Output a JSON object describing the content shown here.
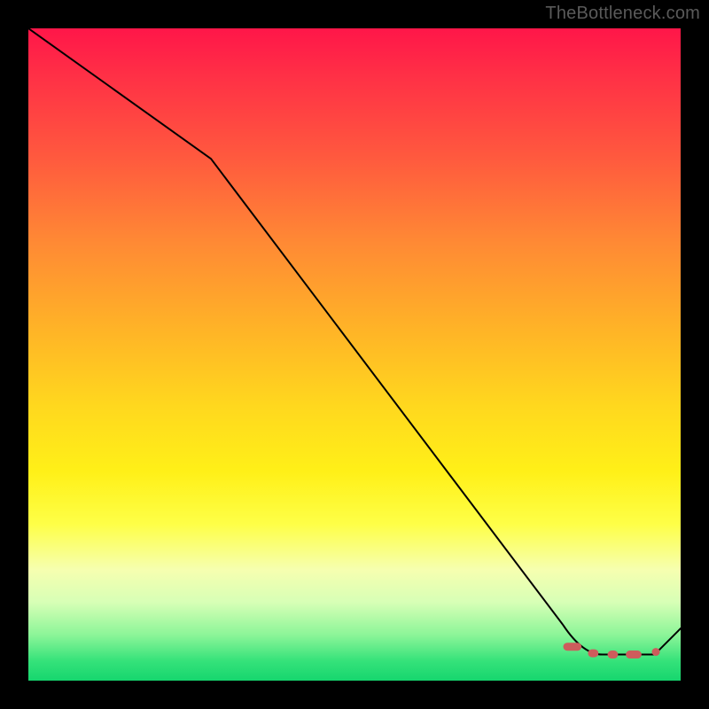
{
  "watermark": "TheBottleneck.com",
  "chart_data": {
    "type": "line",
    "title": "",
    "xlabel": "",
    "ylabel": "",
    "xlim": [
      0,
      100
    ],
    "ylim": [
      0,
      100
    ],
    "grid": false,
    "legend": false,
    "curve": {
      "description": "black curve descending from top-left to a flat minimum near bottom-right then ticking up",
      "x": [
        0,
        28,
        82,
        88,
        96,
        100
      ],
      "y": [
        100,
        80,
        8.5,
        4,
        4,
        8
      ]
    },
    "markers": {
      "description": "small indian-red pill-shaped markers along the flat near-bottom segment and one dot near the right end",
      "pills": [
        {
          "x_start": 82.0,
          "x_end": 84.8,
          "y": 5.2
        },
        {
          "x_start": 85.8,
          "x_end": 87.4,
          "y": 4.2
        },
        {
          "x_start": 88.8,
          "x_end": 90.4,
          "y": 4.0
        },
        {
          "x_start": 91.6,
          "x_end": 94.0,
          "y": 4.0
        }
      ],
      "dot": {
        "x": 96.2,
        "y": 4.4
      }
    },
    "background_gradient": {
      "orientation": "vertical",
      "stops": [
        {
          "pos": 0.0,
          "color": "#ff1649"
        },
        {
          "pos": 0.2,
          "color": "#ff5a3e"
        },
        {
          "pos": 0.46,
          "color": "#ffb327"
        },
        {
          "pos": 0.68,
          "color": "#fff018"
        },
        {
          "pos": 0.88,
          "color": "#d7ffb6"
        },
        {
          "pos": 1.0,
          "color": "#16d66e"
        }
      ]
    }
  }
}
